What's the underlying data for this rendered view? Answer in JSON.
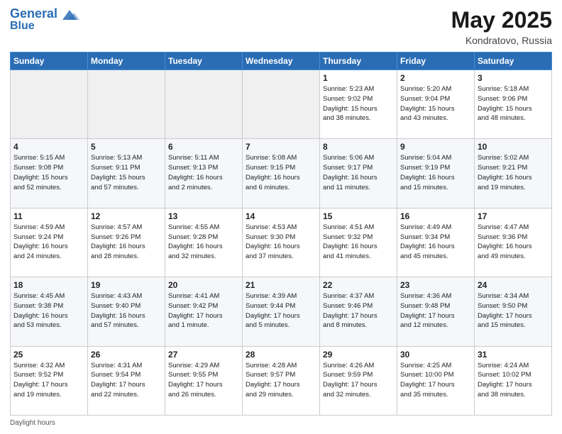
{
  "header": {
    "logo_line1": "General",
    "logo_line2": "Blue",
    "title": "May 2025",
    "location": "Kondratovo, Russia"
  },
  "days_of_week": [
    "Sunday",
    "Monday",
    "Tuesday",
    "Wednesday",
    "Thursday",
    "Friday",
    "Saturday"
  ],
  "weeks": [
    [
      {
        "day": "",
        "info": ""
      },
      {
        "day": "",
        "info": ""
      },
      {
        "day": "",
        "info": ""
      },
      {
        "day": "",
        "info": ""
      },
      {
        "day": "1",
        "info": "Sunrise: 5:23 AM\nSunset: 9:02 PM\nDaylight: 15 hours\nand 38 minutes."
      },
      {
        "day": "2",
        "info": "Sunrise: 5:20 AM\nSunset: 9:04 PM\nDaylight: 15 hours\nand 43 minutes."
      },
      {
        "day": "3",
        "info": "Sunrise: 5:18 AM\nSunset: 9:06 PM\nDaylight: 15 hours\nand 48 minutes."
      }
    ],
    [
      {
        "day": "4",
        "info": "Sunrise: 5:15 AM\nSunset: 9:08 PM\nDaylight: 15 hours\nand 52 minutes."
      },
      {
        "day": "5",
        "info": "Sunrise: 5:13 AM\nSunset: 9:11 PM\nDaylight: 15 hours\nand 57 minutes."
      },
      {
        "day": "6",
        "info": "Sunrise: 5:11 AM\nSunset: 9:13 PM\nDaylight: 16 hours\nand 2 minutes."
      },
      {
        "day": "7",
        "info": "Sunrise: 5:08 AM\nSunset: 9:15 PM\nDaylight: 16 hours\nand 6 minutes."
      },
      {
        "day": "8",
        "info": "Sunrise: 5:06 AM\nSunset: 9:17 PM\nDaylight: 16 hours\nand 11 minutes."
      },
      {
        "day": "9",
        "info": "Sunrise: 5:04 AM\nSunset: 9:19 PM\nDaylight: 16 hours\nand 15 minutes."
      },
      {
        "day": "10",
        "info": "Sunrise: 5:02 AM\nSunset: 9:21 PM\nDaylight: 16 hours\nand 19 minutes."
      }
    ],
    [
      {
        "day": "11",
        "info": "Sunrise: 4:59 AM\nSunset: 9:24 PM\nDaylight: 16 hours\nand 24 minutes."
      },
      {
        "day": "12",
        "info": "Sunrise: 4:57 AM\nSunset: 9:26 PM\nDaylight: 16 hours\nand 28 minutes."
      },
      {
        "day": "13",
        "info": "Sunrise: 4:55 AM\nSunset: 9:28 PM\nDaylight: 16 hours\nand 32 minutes."
      },
      {
        "day": "14",
        "info": "Sunrise: 4:53 AM\nSunset: 9:30 PM\nDaylight: 16 hours\nand 37 minutes."
      },
      {
        "day": "15",
        "info": "Sunrise: 4:51 AM\nSunset: 9:32 PM\nDaylight: 16 hours\nand 41 minutes."
      },
      {
        "day": "16",
        "info": "Sunrise: 4:49 AM\nSunset: 9:34 PM\nDaylight: 16 hours\nand 45 minutes."
      },
      {
        "day": "17",
        "info": "Sunrise: 4:47 AM\nSunset: 9:36 PM\nDaylight: 16 hours\nand 49 minutes."
      }
    ],
    [
      {
        "day": "18",
        "info": "Sunrise: 4:45 AM\nSunset: 9:38 PM\nDaylight: 16 hours\nand 53 minutes."
      },
      {
        "day": "19",
        "info": "Sunrise: 4:43 AM\nSunset: 9:40 PM\nDaylight: 16 hours\nand 57 minutes."
      },
      {
        "day": "20",
        "info": "Sunrise: 4:41 AM\nSunset: 9:42 PM\nDaylight: 17 hours\nand 1 minute."
      },
      {
        "day": "21",
        "info": "Sunrise: 4:39 AM\nSunset: 9:44 PM\nDaylight: 17 hours\nand 5 minutes."
      },
      {
        "day": "22",
        "info": "Sunrise: 4:37 AM\nSunset: 9:46 PM\nDaylight: 17 hours\nand 8 minutes."
      },
      {
        "day": "23",
        "info": "Sunrise: 4:36 AM\nSunset: 9:48 PM\nDaylight: 17 hours\nand 12 minutes."
      },
      {
        "day": "24",
        "info": "Sunrise: 4:34 AM\nSunset: 9:50 PM\nDaylight: 17 hours\nand 15 minutes."
      }
    ],
    [
      {
        "day": "25",
        "info": "Sunrise: 4:32 AM\nSunset: 9:52 PM\nDaylight: 17 hours\nand 19 minutes."
      },
      {
        "day": "26",
        "info": "Sunrise: 4:31 AM\nSunset: 9:54 PM\nDaylight: 17 hours\nand 22 minutes."
      },
      {
        "day": "27",
        "info": "Sunrise: 4:29 AM\nSunset: 9:55 PM\nDaylight: 17 hours\nand 26 minutes."
      },
      {
        "day": "28",
        "info": "Sunrise: 4:28 AM\nSunset: 9:57 PM\nDaylight: 17 hours\nand 29 minutes."
      },
      {
        "day": "29",
        "info": "Sunrise: 4:26 AM\nSunset: 9:59 PM\nDaylight: 17 hours\nand 32 minutes."
      },
      {
        "day": "30",
        "info": "Sunrise: 4:25 AM\nSunset: 10:00 PM\nDaylight: 17 hours\nand 35 minutes."
      },
      {
        "day": "31",
        "info": "Sunrise: 4:24 AM\nSunset: 10:02 PM\nDaylight: 17 hours\nand 38 minutes."
      }
    ]
  ],
  "footer": "Daylight hours"
}
